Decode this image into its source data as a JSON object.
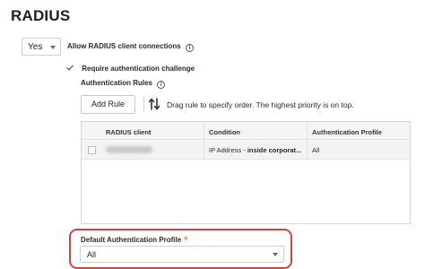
{
  "page": {
    "title": "RADIUS"
  },
  "allow_connections": {
    "select_value": "Yes",
    "label": "Allow RADIUS client connections",
    "info_glyph": "i"
  },
  "require_challenge": {
    "checked": true,
    "label": "Require authentication challenge"
  },
  "authentication_rules": {
    "label": "Authentication Rules",
    "info_glyph": "i",
    "add_rule_label": "Add Rule",
    "drag_hint": "Drag rule to specify order. The highest priority is on top.",
    "table": {
      "columns": [
        "RADIUS client",
        "Condition",
        "Authentication Profile"
      ],
      "rows": [
        {
          "radius_client": "",
          "condition_prefix": "IP Address - ",
          "condition_value": "inside corporat...",
          "profile": "All"
        }
      ]
    }
  },
  "default_auth_profile": {
    "label": "Default Authentication Profile",
    "required_mark": "*",
    "select_value": "All"
  },
  "colors": {
    "highlight": "#d9423e",
    "required": "#f28c1b"
  }
}
